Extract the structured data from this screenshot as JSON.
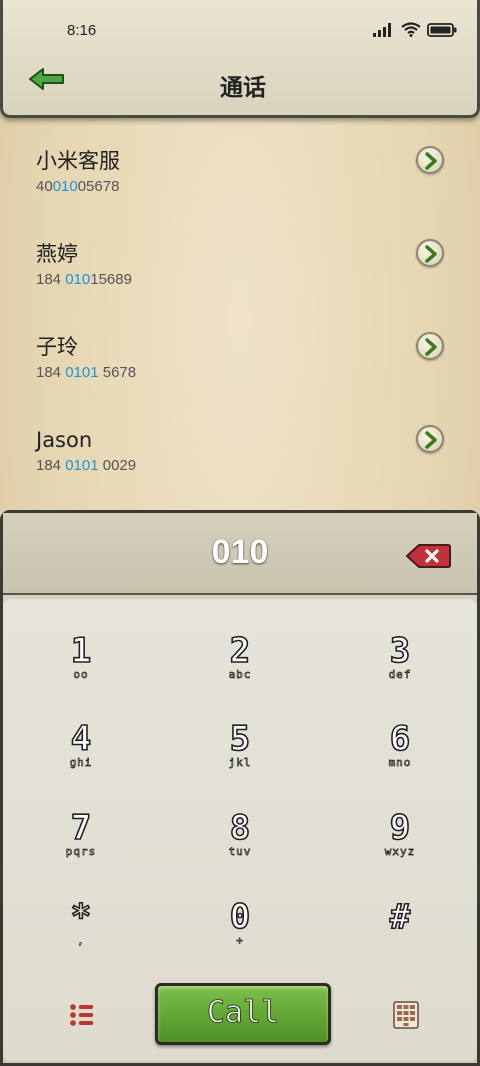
{
  "status": {
    "time": "8:16"
  },
  "header": {
    "title": "通话",
    "back_icon": "back-arrow-icon"
  },
  "contacts": [
    {
      "name": "小米客服",
      "num_pre": "40",
      "num_hl": "010",
      "num_post": "05678"
    },
    {
      "name": "燕婷",
      "num_pre": "184 ",
      "num_hl": "010",
      "num_post": "15689"
    },
    {
      "name": "子玲",
      "num_pre": "184 ",
      "num_hl": "0101",
      "num_post": " 5678"
    },
    {
      "name": "Jason",
      "num_pre": "184 ",
      "num_hl": "0101",
      "num_post": " 0029"
    }
  ],
  "dialer": {
    "number": "010",
    "keys": [
      {
        "digit": "1",
        "letters": "oo"
      },
      {
        "digit": "2",
        "letters": "abc"
      },
      {
        "digit": "3",
        "letters": "def"
      },
      {
        "digit": "4",
        "letters": "ghi"
      },
      {
        "digit": "5",
        "letters": "jkl"
      },
      {
        "digit": "6",
        "letters": "mno"
      },
      {
        "digit": "7",
        "letters": "pqrs"
      },
      {
        "digit": "8",
        "letters": "tuv"
      },
      {
        "digit": "9",
        "letters": "wxyz"
      },
      {
        "digit": "*",
        "letters": ","
      },
      {
        "digit": "0",
        "letters": "+"
      },
      {
        "digit": "#",
        "letters": ""
      }
    ],
    "call_label": "Call"
  },
  "colors": {
    "highlight": "#1f93d6",
    "call_green": "#5fa432",
    "delete_red": "#c0313b"
  }
}
